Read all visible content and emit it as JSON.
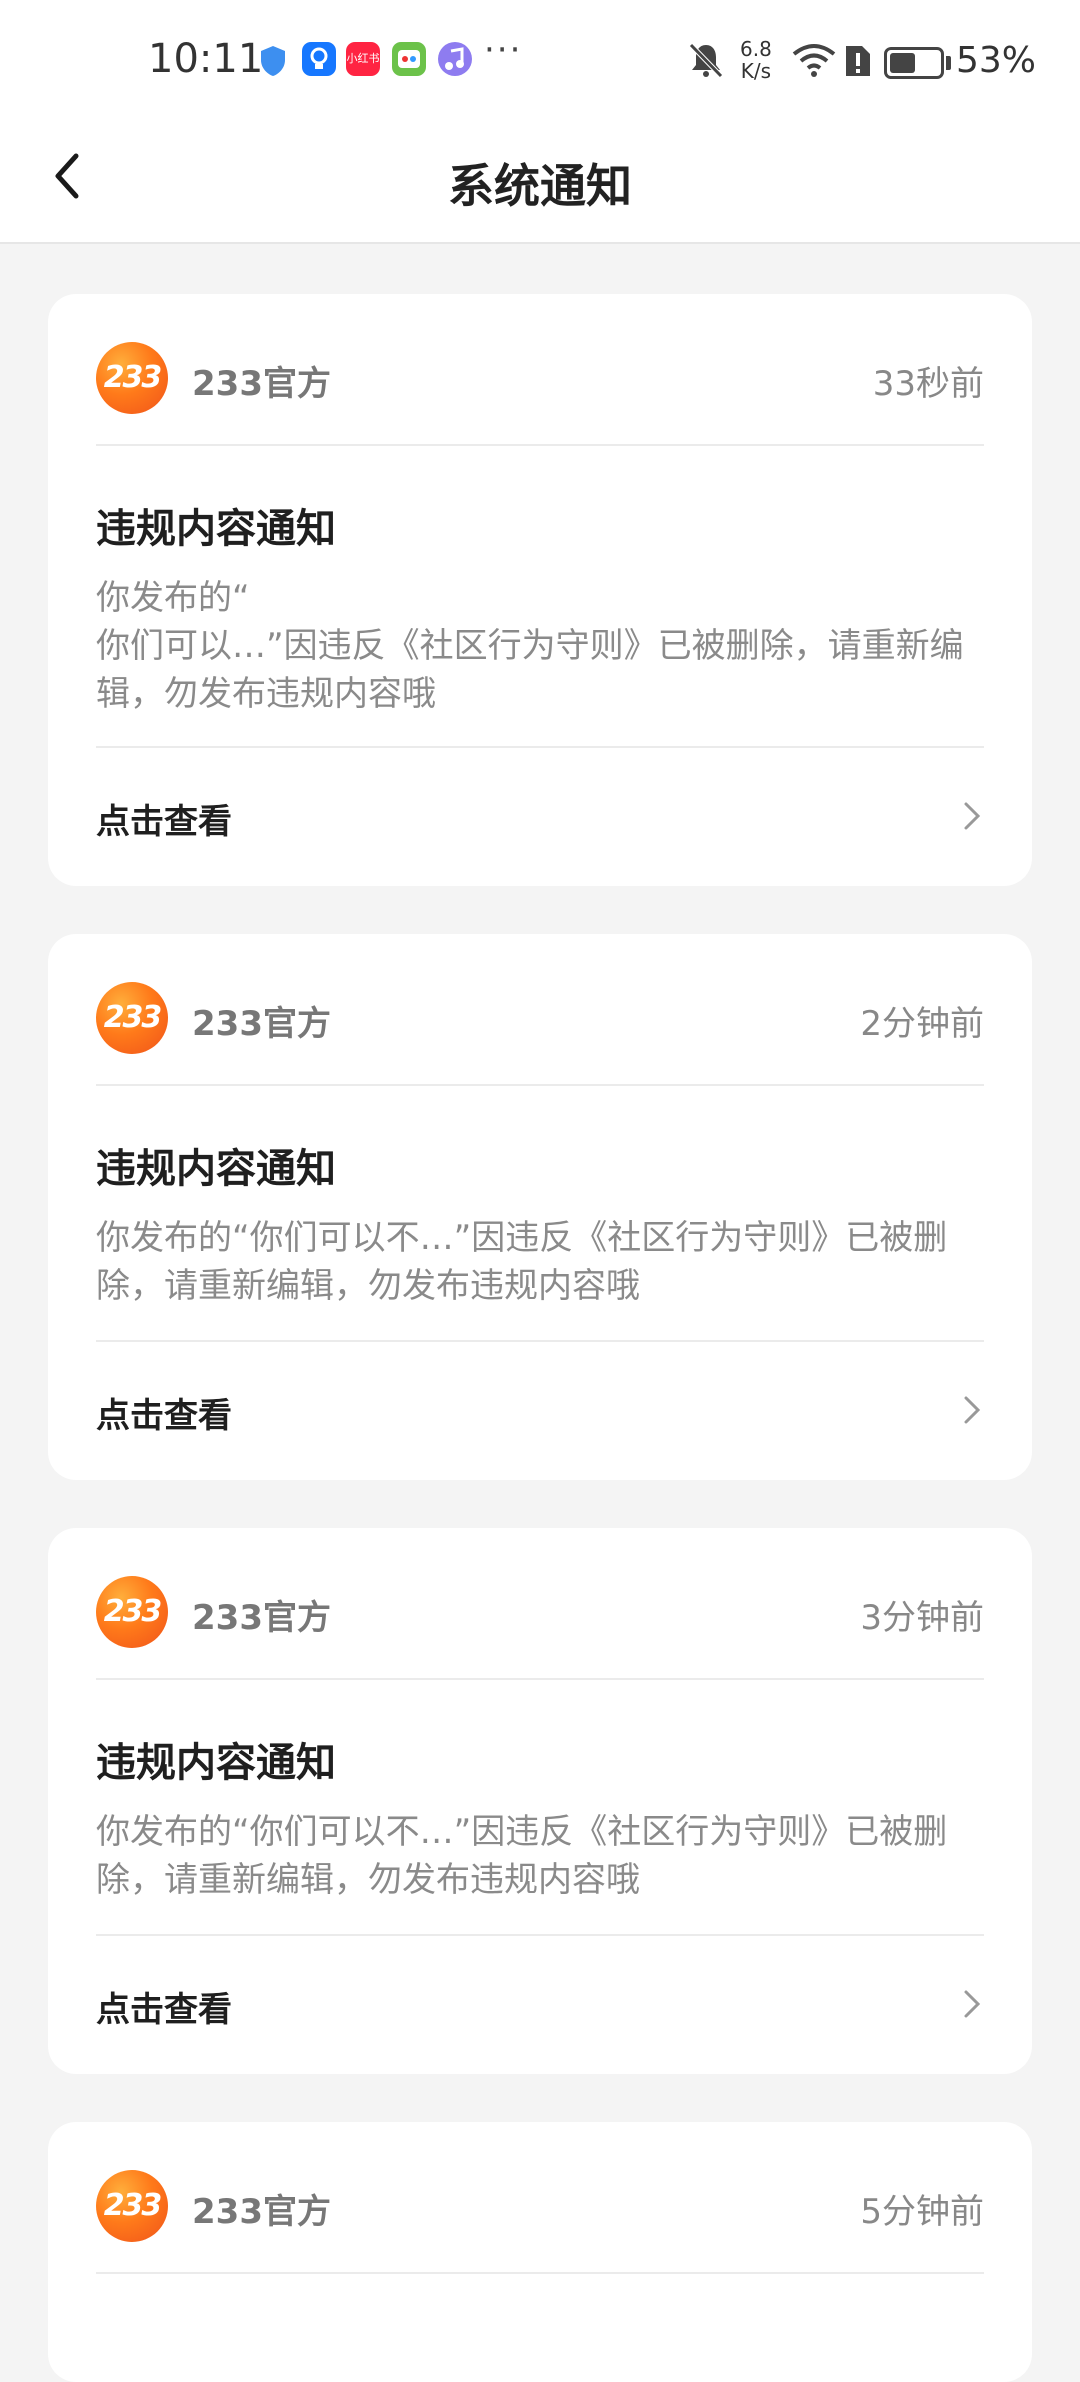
{
  "status_bar": {
    "time": "10:11",
    "icons": [
      "shield-icon",
      "bulb-app-icon",
      "xiaohongshu-app-icon",
      "game-app-icon",
      "music-app-icon"
    ],
    "xiaohongshu_label": "小红书",
    "more": "···",
    "net_speed_value": "6.8",
    "net_speed_unit": "K/s",
    "battery_percent": "53%",
    "battery_level": 0.53
  },
  "header": {
    "title": "系统通知"
  },
  "notifications": [
    {
      "sender": "233官方",
      "avatar_text": "233",
      "time": "33秒前",
      "title": "违规内容通知",
      "body": "你发布的“\n你们可以…”因违反《社区行为守则》已被删除，请重新编辑，勿发布违规内容哦",
      "link": "点击查看"
    },
    {
      "sender": "233官方",
      "avatar_text": "233",
      "time": "2分钟前",
      "title": "违规内容通知",
      "body": "你发布的“你们可以不…”因违反《社区行为守则》已被删除，请重新编辑，勿发布违规内容哦",
      "link": "点击查看"
    },
    {
      "sender": "233官方",
      "avatar_text": "233",
      "time": "3分钟前",
      "title": "违规内容通知",
      "body": "你发布的“你们可以不…”因违反《社区行为守则》已被删除，请重新编辑，勿发布违规内容哦",
      "link": "点击查看"
    },
    {
      "sender": "233官方",
      "avatar_text": "233",
      "time": "5分钟前"
    }
  ],
  "colors": {
    "background": "#f4f4f4",
    "card": "#ffffff",
    "avatar_orange": "#ff7a1a",
    "muted_text": "#8a8a8a"
  }
}
